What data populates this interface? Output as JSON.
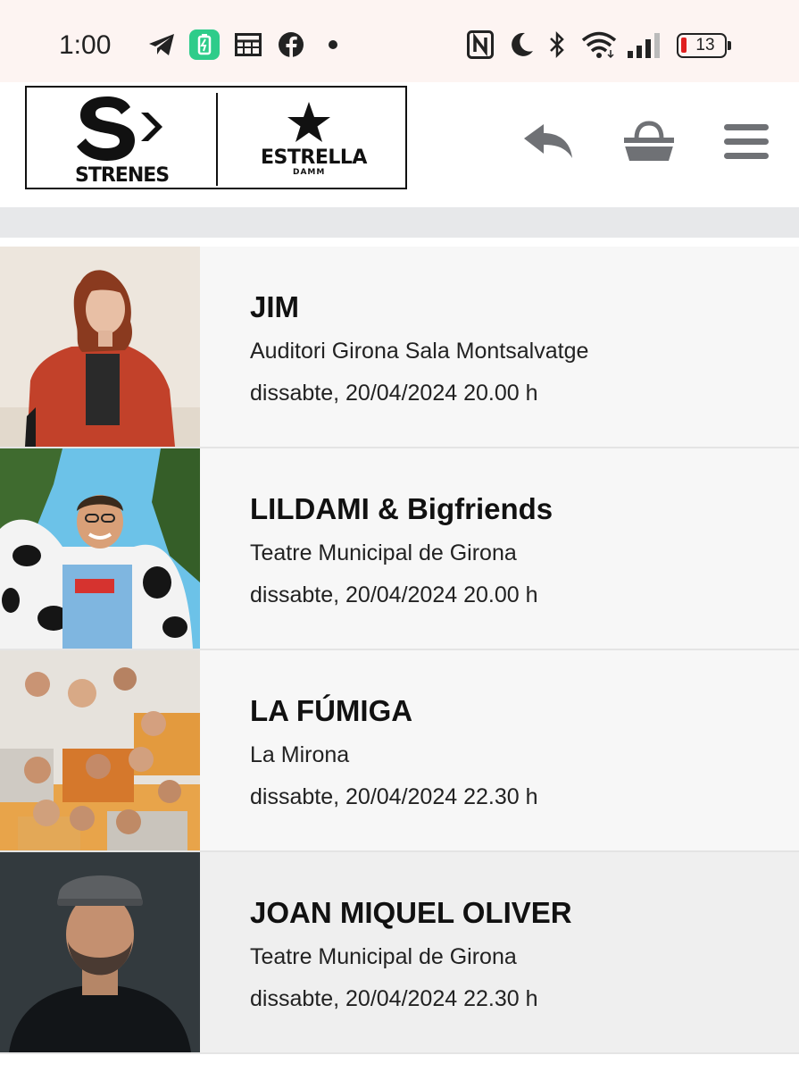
{
  "status_bar": {
    "time": "1:00",
    "battery_percent": "13",
    "left_icons": [
      "telegram-icon",
      "battery-saver-icon",
      "calendar-grid-icon",
      "facebook-icon",
      "dot-icon"
    ],
    "right_icons": [
      "nfc-icon",
      "moon-icon",
      "bluetooth-icon",
      "wifi-icon",
      "signal-icon",
      "battery-icon"
    ]
  },
  "header": {
    "logo": {
      "brand_left": "STRENES",
      "brand_right": "ESTRELLA",
      "brand_right_sub": "DAMM"
    },
    "icons": [
      "back-arrow-icon",
      "basket-icon",
      "hamburger-menu-icon"
    ]
  },
  "events": [
    {
      "title": "JIM",
      "venue": "Auditori Girona Sala Montsalvatge",
      "date": "dissabte, 20/04/2024 20.00 h"
    },
    {
      "title": "LILDAMI & Bigfriends",
      "venue": "Teatre Municipal de Girona",
      "date": "dissabte, 20/04/2024 20.00 h"
    },
    {
      "title": "LA FÚMIGA",
      "venue": "La Mirona",
      "date": "dissabte, 20/04/2024 22.30 h"
    },
    {
      "title": "JOAN MIQUEL OLIVER",
      "venue": "Teatre Municipal de Girona",
      "date": "dissabte, 20/04/2024 22.30 h"
    }
  ],
  "colors": {
    "status_bar_bg": "#fdf4f2",
    "icon_grey": "#6f7175",
    "row_bg": "#f7f7f7",
    "band_grey": "#e7e8ea"
  }
}
